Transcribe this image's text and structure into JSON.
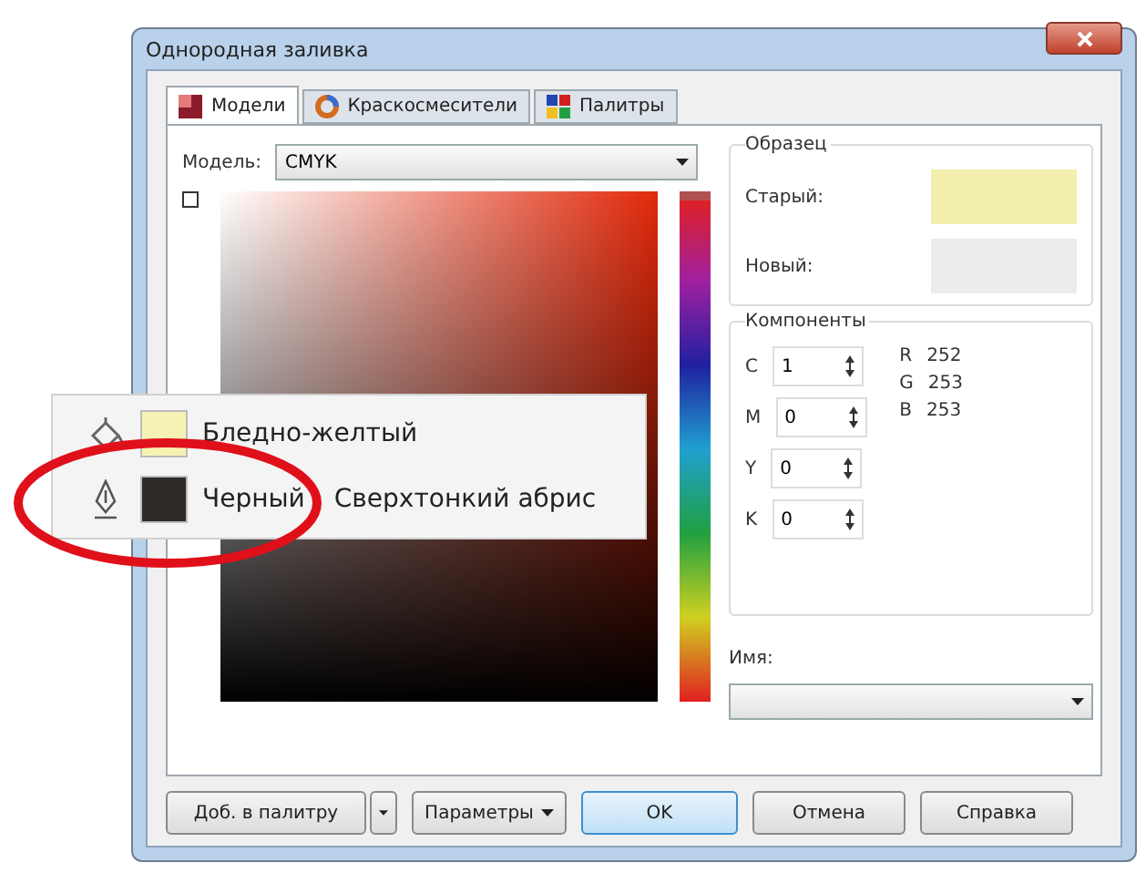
{
  "window": {
    "title": "Однородная заливка"
  },
  "tabs": [
    {
      "label": "Модели",
      "selected": true
    },
    {
      "label": "Краскосмесители",
      "selected": false
    },
    {
      "label": "Палитры",
      "selected": false
    }
  ],
  "model": {
    "label": "Модель:",
    "value": "CMYK"
  },
  "color_field": {
    "checked": false
  },
  "hue": {
    "level": 0
  },
  "sample": {
    "title": "Образец",
    "old_label": "Старый:",
    "new_label": "Новый:"
  },
  "components": {
    "title": "Компоненты",
    "fields": [
      {
        "letter": "C",
        "value": "1"
      },
      {
        "letter": "M",
        "value": "0"
      },
      {
        "letter": "Y",
        "value": "0"
      },
      {
        "letter": "K",
        "value": "0"
      }
    ],
    "rgb": [
      {
        "letter": "R",
        "value": "252"
      },
      {
        "letter": "G",
        "value": "253"
      },
      {
        "letter": "B",
        "value": "253"
      }
    ]
  },
  "name": {
    "label": "Имя:"
  },
  "buttons": [
    {
      "label": "Доб. в палитру",
      "kind": "split"
    },
    {
      "label": "Параметры",
      "kind": "menu"
    },
    {
      "label": "OK",
      "kind": "default"
    },
    {
      "label": "Отмена",
      "kind": "plain"
    },
    {
      "label": "Справка",
      "kind": "plain"
    }
  ],
  "callout": {
    "rows": [
      {
        "kind": "fill",
        "color": "#f6f2b4",
        "texts": [
          "Бледно-желтый"
        ],
        "circled": false
      },
      {
        "kind": "outline",
        "color": "#2e2a28",
        "texts": [
          "Черный",
          "Сверхтонкий абрис"
        ],
        "circled": true
      }
    ]
  }
}
